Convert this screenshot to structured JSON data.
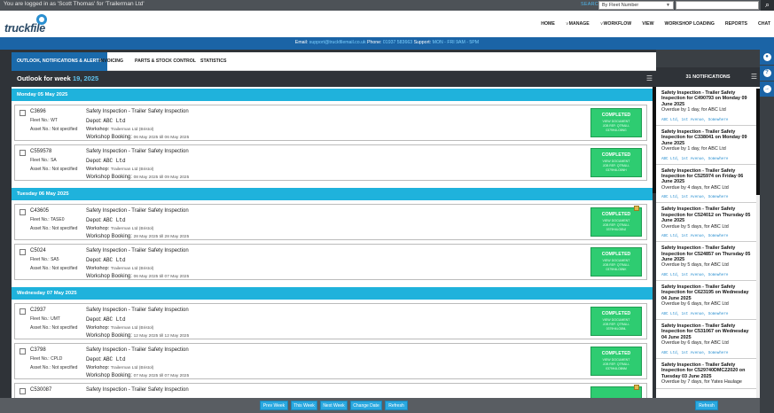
{
  "topbar": {
    "logged_in_text": "You are logged in as 'Scott Thomas' for 'Trailerman Ltd'",
    "search_label": "SEARCH",
    "search_by_selected": "By Fleet Number",
    "search_value": ""
  },
  "header": {
    "logo_text": "truckfile",
    "nav": [
      {
        "label": "HOME",
        "dropdown": false
      },
      {
        "label": "MANAGE",
        "dropdown": true
      },
      {
        "label": "WORKFLOW",
        "dropdown": true
      },
      {
        "label": "VIEW",
        "dropdown": false
      },
      {
        "label": "WORKSHOP LOADING",
        "dropdown": false
      },
      {
        "label": "REPORTS",
        "dropdown": false
      },
      {
        "label": "CHAT",
        "dropdown": false
      }
    ]
  },
  "banner": {
    "email_label": "Email:",
    "email": "support@truckfilemail.co.uk",
    "phone_label": "Phone:",
    "phone": "01937 583663",
    "support_label": "Support:",
    "support_hours": "MON - FRI 9AM - 5PM"
  },
  "tabs": [
    {
      "label": "OUTLOOK, NOTIFICATIONS & ALERTS",
      "active": true
    },
    {
      "label": "INVOICING",
      "active": false
    },
    {
      "label": "PARTS & STOCK CONTROL",
      "active": false
    },
    {
      "label": "STATISTICS",
      "active": false
    }
  ],
  "outlook": {
    "title_prefix": "Outlook for week",
    "week": "19, 2025"
  },
  "labels": {
    "fleet_prefix": "Fleet No.:",
    "asset": "Asset No.: Not specified",
    "depot_prefix": "Depot:",
    "workshop_prefix": "Workshop:",
    "booking_prefix": "Workshop Booking:"
  },
  "days": [
    {
      "header": "Monday 05 May 2025",
      "entries": [
        {
          "reg": "C3696",
          "fleet": "WT",
          "job": "Safety Inspection - Trailer Safety Inspection",
          "depot": "ABC Ltd",
          "workshop": "Trailerman Ltd (Bristol)",
          "booking": "06 May 2025 till 06 May 2025",
          "status": "COMPLETED",
          "status_link": "VIEW DOCUMENT",
          "status_ref": "JOB REF: QTRAILI-",
          "status_ref2": "0379H4LO8NG",
          "flag": false
        },
        {
          "reg": "C559578",
          "fleet": "SA",
          "job": "Safety Inspection - Trailer Safety Inspection",
          "depot": "ABC Ltd",
          "workshop": "Trailerman Ltd (Bristol)",
          "booking": "08 May 2025 till 09 May 2025",
          "status": "COMPLETED",
          "status_link": "VIEW DOCUMENT",
          "status_ref": "JOB REF: QTRAILI-",
          "status_ref2": "0379H4LO8NH",
          "flag": false
        }
      ]
    },
    {
      "header": "Tuesday 06 May 2025",
      "entries": [
        {
          "reg": "C43605",
          "fleet": "TASE0",
          "job": "Safety Inspection - Trailer Safety Inspection",
          "depot": "ABC Ltd",
          "workshop": "Trailerman Ltd (Bristol)",
          "booking": "28 May 2025 till 28 May 2025",
          "status": "COMPLETED",
          "status_link": "VIEW DOCUMENT",
          "status_ref": "JOB REF: QTRAILI-",
          "status_ref2": "0379H4LO8NJ",
          "flag": true
        },
        {
          "reg": "C5024",
          "fleet": "SA5",
          "job": "Safety Inspection - Trailer Safety Inspection",
          "depot": "ABC Ltd",
          "workshop": "Trailerman Ltd (Bristol)",
          "booking": "06 May 2025 till 07 May 2025",
          "status": "COMPLETED",
          "status_link": "VIEW DOCUMENT",
          "status_ref": "JOB REF: QTRAILI-",
          "status_ref2": "0379H4LO8NK",
          "flag": false
        }
      ]
    },
    {
      "header": "Wednesday 07 May 2025",
      "entries": [
        {
          "reg": "C2937",
          "fleet": "UMT",
          "job": "Safety Inspection - Trailer Safety Inspection",
          "depot": "ABC Ltd",
          "workshop": "Trailerman Ltd (Bristol)",
          "booking": "12 May 2025 till 12 May 2025",
          "status": "COMPLETED",
          "status_link": "VIEW DOCUMENT",
          "status_ref": "JOB REF: QTRAILI-",
          "status_ref2": "0379H4LO8NL",
          "flag": false
        },
        {
          "reg": "C3798",
          "fleet": "CPLD",
          "job": "Safety Inspection - Trailer Safety Inspection",
          "depot": "ABC Ltd",
          "workshop": "Trailerman Ltd (Bristol)",
          "booking": "07 May 2025 till 07 May 2025",
          "status": "COMPLETED",
          "status_link": "VIEW DOCUMENT",
          "status_ref": "JOB REF: QTRAILI-",
          "status_ref2": "0379H4LO8NM",
          "flag": false
        },
        {
          "reg": "C530087",
          "fleet": "",
          "job": "Safety Inspection - Trailer Safety Inspection",
          "depot": "",
          "workshop": "",
          "booking": "",
          "status": "",
          "status_link": "",
          "status_ref": "",
          "status_ref2": "",
          "flag": true
        }
      ]
    }
  ],
  "bottom_buttons": [
    "Prev Week",
    "This Week",
    "Next Week",
    "Change Date",
    "Refresh"
  ],
  "notifications": {
    "count_label": "31 NOTIFICATIONS",
    "refresh_label": "Refresh",
    "items": [
      {
        "title": "Safety Inspection - Trailer Safety Inspection for C490793 on Monday 09 June 2025",
        "status": "Overdue by 1 day, for ABC Ltd",
        "address": "ABC Ltd, 1st Avenue, Somewhere"
      },
      {
        "title": "Safety Inspection - Trailer Safety Inspection for C338041 on Monday 09 June 2025",
        "status": "Overdue by 1 day, for ABC Ltd",
        "address": "ABC Ltd, 1st Avenue, Somewhere"
      },
      {
        "title": "Safety Inspection - Trailer Safety Inspection for C525974 on Friday 06 June 2025",
        "status": "Overdue by 4 days, for ABC Ltd",
        "address": "ABC Ltd, 1st Avenue, Somewhere"
      },
      {
        "title": "Safety Inspection - Trailer Safety Inspection for C524012 on Thursday 05 June 2025",
        "status": "Overdue by 5 days, for ABC Ltd",
        "address": "ABC Ltd, 1st Avenue, Somewhere"
      },
      {
        "title": "Safety Inspection - Trailer Safety Inspection for C524857 on Thursday 05 June 2025",
        "status": "Overdue by 5 days, for ABC Ltd",
        "address": "ABC Ltd, 1st Avenue, Somewhere"
      },
      {
        "title": "Safety Inspection - Trailer Safety Inspection for C623195 on Wednesday 04 June 2025",
        "status": "Overdue by 6 days, for ABC Ltd",
        "address": "ABC Ltd, 1st Avenue, Somewhere"
      },
      {
        "title": "Safety Inspection - Trailer Safety Inspection for C531067 on Wednesday 04 June 2025",
        "status": "Overdue by 6 days, for ABC Ltd",
        "address": "ABC Ltd, 1st Avenue, Somewhere"
      },
      {
        "title": "Safety Inspection - Trailer Safety Inspection for C529740DMC22020 on Tuesday 03 June 2025",
        "status": "Overdue by 7 days, for Yates Haulage",
        "address": ""
      }
    ]
  },
  "colors": {
    "accent_blue": "#1b64a6",
    "day_header": "#1fb2dc",
    "completed": "#2ecc71",
    "button": "#29a8e0"
  }
}
